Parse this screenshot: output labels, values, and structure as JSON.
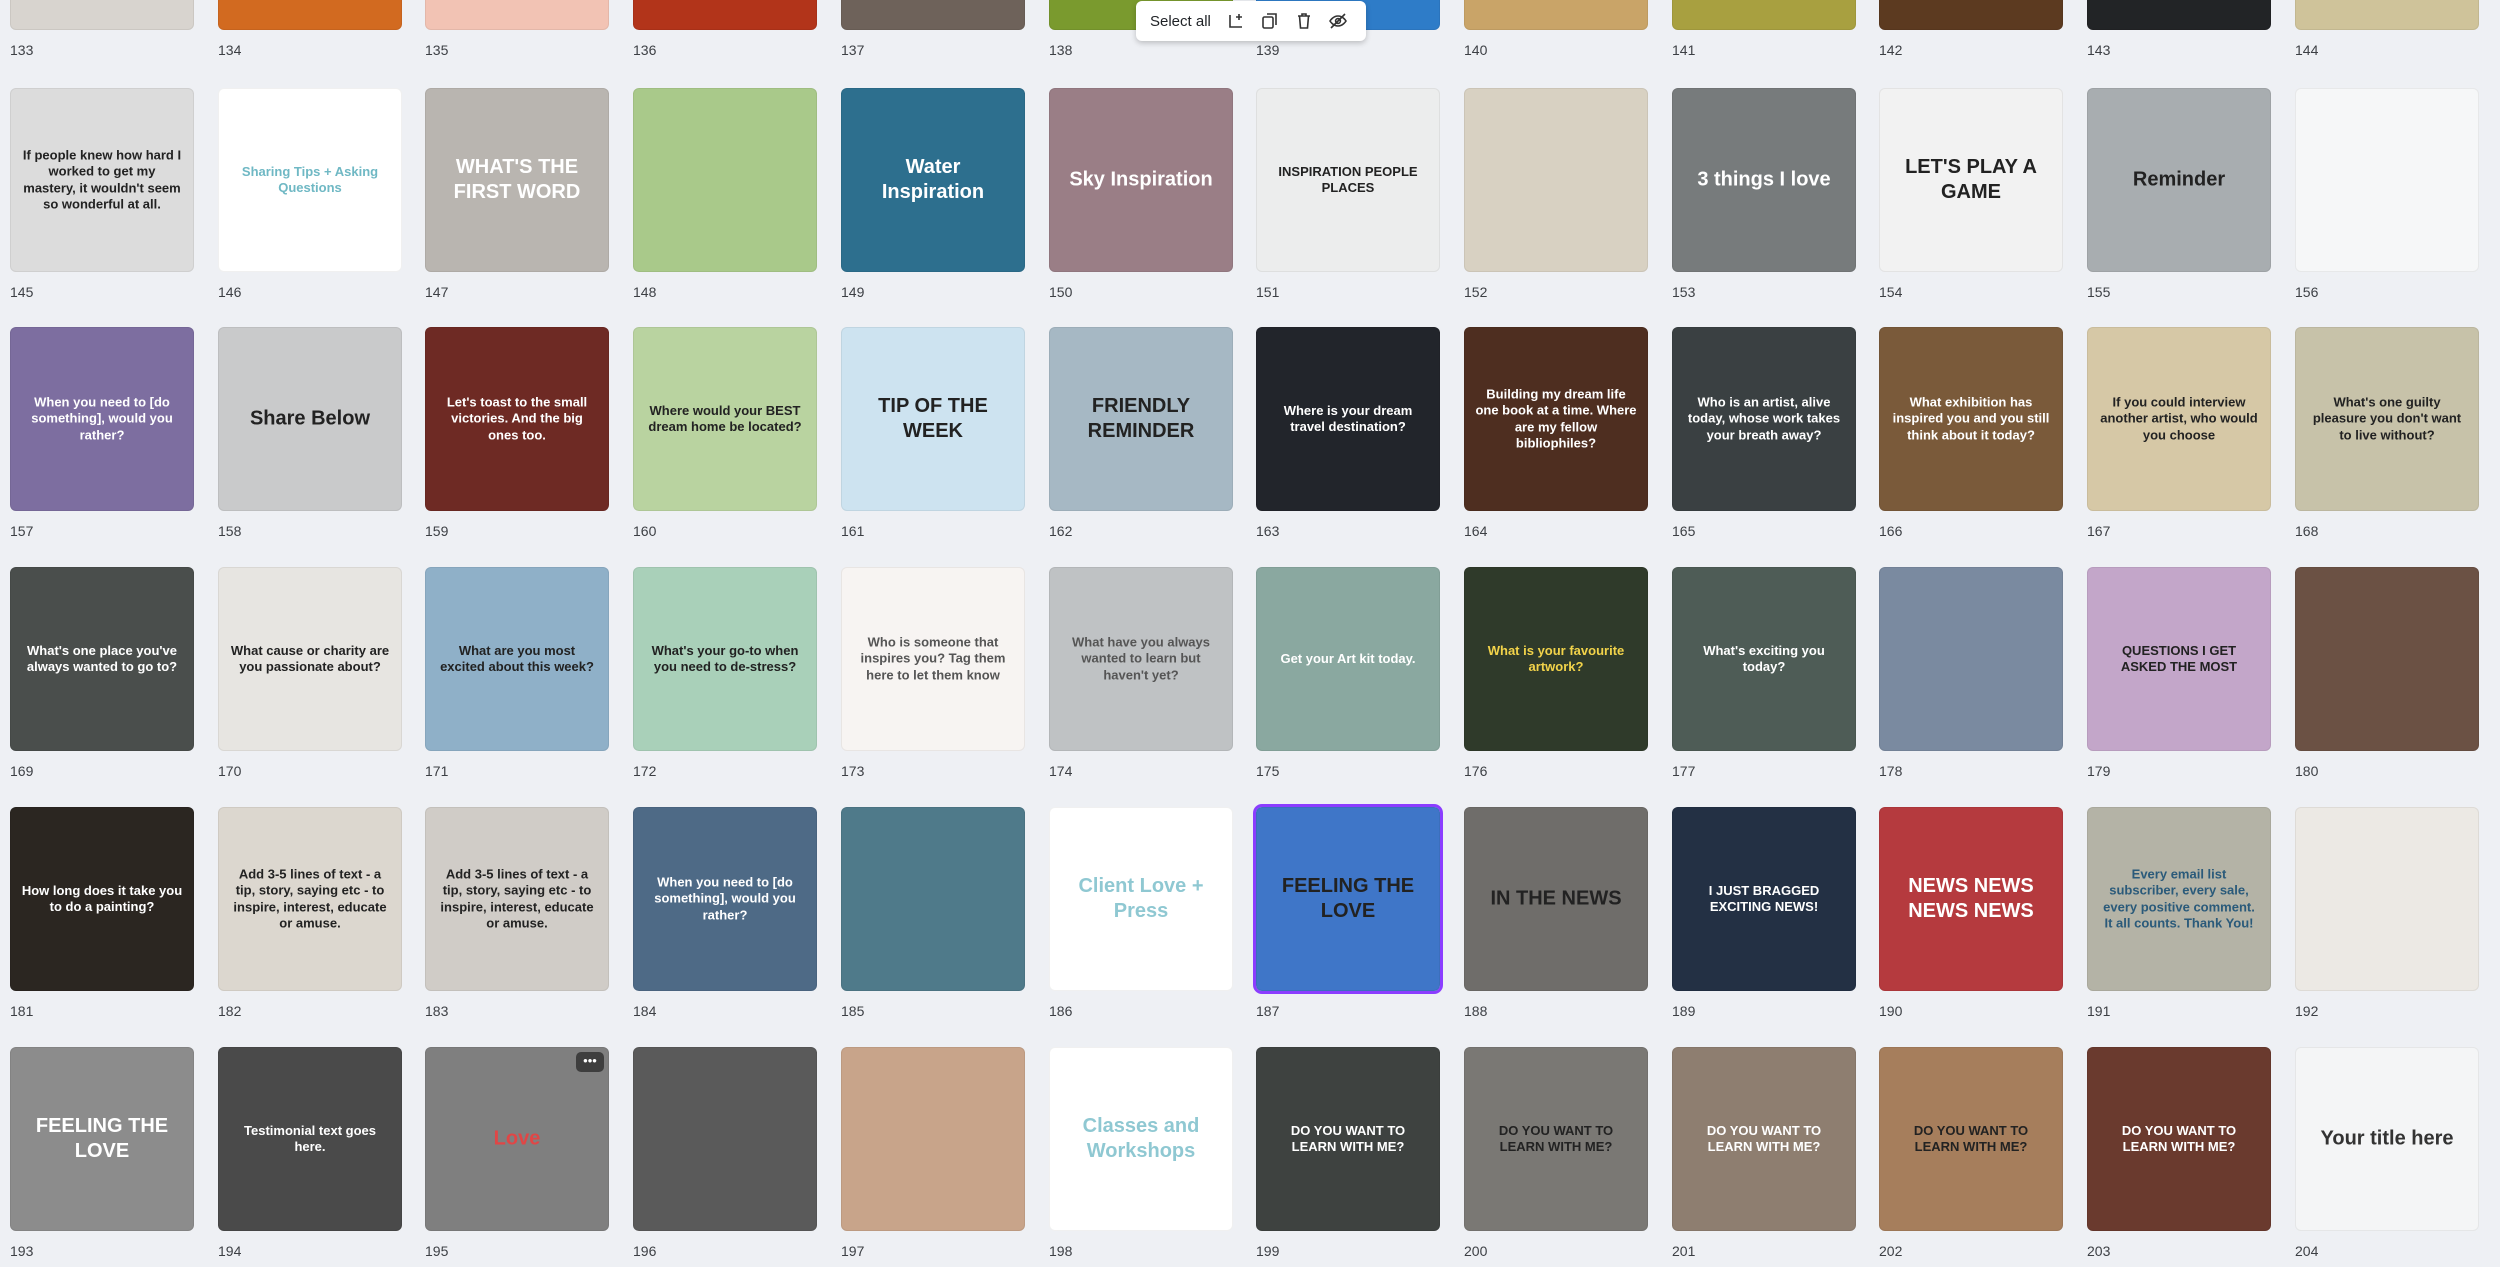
{
  "toolbar": {
    "select_all_label": "Select all"
  },
  "rows": [
    {
      "pages": [
        {
          "number": "133",
          "bg": "#d8d4cf",
          "text": "",
          "fg": "#333"
        },
        {
          "number": "134",
          "bg": "#d26a20",
          "text": "",
          "fg": "#fff"
        },
        {
          "number": "135",
          "bg": "#f2c3b4",
          "text": "",
          "fg": "#333"
        },
        {
          "number": "136",
          "bg": "#b2341a",
          "text": "",
          "fg": "#fff"
        },
        {
          "number": "137",
          "bg": "#6e625a",
          "text": "",
          "fg": "#fff"
        },
        {
          "number": "138",
          "bg": "#7a9a2e",
          "text": "",
          "fg": "#fff"
        },
        {
          "number": "139",
          "bg": "#2e7cc8",
          "text": "",
          "fg": "#fff"
        },
        {
          "number": "140",
          "bg": "#c9a468",
          "text": "",
          "fg": "#333"
        },
        {
          "number": "141",
          "bg": "#a8a040",
          "text": "",
          "fg": "#333"
        },
        {
          "number": "142",
          "bg": "#5c3a20",
          "text": "",
          "fg": "#fff"
        },
        {
          "number": "143",
          "bg": "#222426",
          "text": "",
          "fg": "#fff"
        },
        {
          "number": "144",
          "bg": "#cfc39a",
          "text": "",
          "fg": "#333"
        }
      ]
    },
    {
      "pages": [
        {
          "number": "145",
          "bg": "#dcdcdc",
          "text": "If people knew how hard I worked to get my mastery, it wouldn't seem so wonderful at all.",
          "fg": "#222"
        },
        {
          "number": "146",
          "bg": "#ffffff",
          "text": "Sharing Tips + Asking Questions",
          "fg": "#6fb8c4"
        },
        {
          "number": "147",
          "bg": "#b9b5b0",
          "text": "WHAT'S THE FIRST WORD",
          "fg": "#ffffff"
        },
        {
          "number": "148",
          "bg": "#a9c98a",
          "text": "",
          "fg": "#333"
        },
        {
          "number": "149",
          "bg": "#2d6f8e",
          "text": "Water Inspiration",
          "fg": "#ffffff"
        },
        {
          "number": "150",
          "bg": "#9a7e86",
          "text": "Sky Inspiration",
          "fg": "#ffffff"
        },
        {
          "number": "151",
          "bg": "#eceded",
          "text": "INSPIRATION PEOPLE PLACES",
          "fg": "#222"
        },
        {
          "number": "152",
          "bg": "#d8d1c2",
          "text": "",
          "fg": "#333"
        },
        {
          "number": "153",
          "bg": "#777b7c",
          "text": "3 things I love",
          "fg": "#ffffff"
        },
        {
          "number": "154",
          "bg": "#f2f2f2",
          "text": "LET'S PLAY A GAME",
          "fg": "#222"
        },
        {
          "number": "155",
          "bg": "#a8adb0",
          "text": "Reminder",
          "fg": "#222"
        },
        {
          "number": "156",
          "bg": "#f6f7f8",
          "text": "",
          "fg": "#333"
        }
      ]
    },
    {
      "pages": [
        {
          "number": "157",
          "bg": "#7d6ea0",
          "text": "When you need to [do something], would you rather?",
          "fg": "#ffffff"
        },
        {
          "number": "158",
          "bg": "#c9cacb",
          "text": "Share Below",
          "fg": "#222"
        },
        {
          "number": "159",
          "bg": "#6e2a24",
          "text": "Let's toast to the small victories. And the big ones too.",
          "fg": "#ffffff"
        },
        {
          "number": "160",
          "bg": "#b9d3a0",
          "text": "Where would your BEST dream home be located?",
          "fg": "#222"
        },
        {
          "number": "161",
          "bg": "#cde3f0",
          "text": "TIP OF THE WEEK",
          "fg": "#222"
        },
        {
          "number": "162",
          "bg": "#a6b8c4",
          "text": "FRIENDLY REMINDER",
          "fg": "#222"
        },
        {
          "number": "163",
          "bg": "#22252b",
          "text": "Where is your dream travel destination?",
          "fg": "#ffffff"
        },
        {
          "number": "164",
          "bg": "#4e2e20",
          "text": "Building my dream life one book at a time. Where are my fellow bibliophiles?",
          "fg": "#ffffff"
        },
        {
          "number": "165",
          "bg": "#3a4042",
          "text": "Who is an artist, alive today, whose work takes your breath away?",
          "fg": "#ffffff"
        },
        {
          "number": "166",
          "bg": "#7a5a3a",
          "text": "What exhibition has inspired you and you still think about it today?",
          "fg": "#ffffff"
        },
        {
          "number": "167",
          "bg": "#d6c8a6",
          "text": "If you could interview another artist, who would you choose",
          "fg": "#222"
        },
        {
          "number": "168",
          "bg": "#c7c2a9",
          "text": "What's one guilty pleasure you don't want to live without?",
          "fg": "#222"
        }
      ]
    },
    {
      "pages": [
        {
          "number": "169",
          "bg": "#4a4e4c",
          "text": "What's one place you've always wanted to go to?",
          "fg": "#ffffff"
        },
        {
          "number": "170",
          "bg": "#e7e5e1",
          "text": "What cause or charity are you passionate about?",
          "fg": "#222"
        },
        {
          "number": "171",
          "bg": "#8fb0c8",
          "text": "What are you most excited about this week?",
          "fg": "#222"
        },
        {
          "number": "172",
          "bg": "#a9d0b9",
          "text": "What's your go-to when you need to de-stress?",
          "fg": "#222"
        },
        {
          "number": "173",
          "bg": "#f7f4f2",
          "text": "Who is someone that inspires you? Tag them here to let them know",
          "fg": "#555"
        },
        {
          "number": "174",
          "bg": "#bfc2c4",
          "text": "What have you always wanted to learn but haven't yet?",
          "fg": "#555"
        },
        {
          "number": "175",
          "bg": "#8aa8a0",
          "text": "Get your Art kit today.",
          "fg": "#ffffff"
        },
        {
          "number": "176",
          "bg": "#2f3a2a",
          "text": "What is your favourite artwork?",
          "fg": "#f2d34a"
        },
        {
          "number": "177",
          "bg": "#4e5c56",
          "text": "What's exciting you today?",
          "fg": "#ffffff"
        },
        {
          "number": "178",
          "bg": "#7a8aa0",
          "text": "",
          "fg": "#fff"
        },
        {
          "number": "179",
          "bg": "#c3a6c9",
          "text": "QUESTIONS I GET ASKED THE MOST",
          "fg": "#222"
        },
        {
          "number": "180",
          "bg": "#6b5144",
          "text": "",
          "fg": "#fff"
        }
      ]
    },
    {
      "pages": [
        {
          "number": "181",
          "bg": "#2b2621",
          "text": "How long does it take you to do a painting?",
          "fg": "#ffffff"
        },
        {
          "number": "182",
          "bg": "#dcd7cf",
          "text": "Add 3-5 lines of text - a tip, story, saying etc - to inspire, interest, educate or amuse.",
          "fg": "#222"
        },
        {
          "number": "183",
          "bg": "#d0ccc7",
          "text": "Add 3-5 lines of text - a tip, story, saying etc - to inspire, interest, educate or amuse.",
          "fg": "#222"
        },
        {
          "number": "184",
          "bg": "#4e6a86",
          "text": "When you need to [do something], would you rather?",
          "fg": "#ffffff"
        },
        {
          "number": "185",
          "bg": "#4f7a8a",
          "text": "",
          "fg": "#fff"
        },
        {
          "number": "186",
          "bg": "#ffffff",
          "text": "Client Love + Press",
          "fg": "#8fc8d2"
        },
        {
          "number": "187",
          "bg": "#3f76c8",
          "text": "FEELING THE LOVE",
          "fg": "#222",
          "selected": true
        },
        {
          "number": "188",
          "bg": "#6f6d6a",
          "text": "IN THE NEWS",
          "fg": "#222"
        },
        {
          "number": "189",
          "bg": "#233044",
          "text": "I JUST BRAGGED EXCITING NEWS!",
          "fg": "#ffffff"
        },
        {
          "number": "190",
          "bg": "#b53a3e",
          "text": "NEWS NEWS NEWS NEWS",
          "fg": "#ffffff"
        },
        {
          "number": "191",
          "bg": "#b4b3a6",
          "text": "Every email list subscriber, every sale, every positive comment. It all counts. Thank You!",
          "fg": "#2a5a7a"
        },
        {
          "number": "192",
          "bg": "#ece9e4",
          "text": "",
          "fg": "#333"
        }
      ]
    },
    {
      "pages": [
        {
          "number": "193",
          "bg": "#8c8c8c",
          "text": "FEELING THE LOVE",
          "fg": "#ffffff"
        },
        {
          "number": "194",
          "bg": "#4a4a4a",
          "text": "Testimonial text goes here.",
          "fg": "#ffffff"
        },
        {
          "number": "195",
          "bg": "#7f7f7f",
          "text": "Love",
          "fg": "#e04646",
          "more": true
        },
        {
          "number": "196",
          "bg": "#5a5a5a",
          "text": "",
          "fg": "#fff"
        },
        {
          "number": "197",
          "bg": "#c8a48a",
          "text": "",
          "fg": "#fff"
        },
        {
          "number": "198",
          "bg": "#ffffff",
          "text": "Classes and Workshops",
          "fg": "#8fc8d2"
        },
        {
          "number": "199",
          "bg": "#3e4240",
          "text": "DO YOU WANT TO LEARN WITH ME?",
          "fg": "#ffffff"
        },
        {
          "number": "200",
          "bg": "#7a7874",
          "text": "DO YOU WANT TO LEARN WITH ME?",
          "fg": "#222"
        },
        {
          "number": "201",
          "bg": "#8e7e70",
          "text": "DO YOU WANT TO LEARN WITH ME?",
          "fg": "#ffffff"
        },
        {
          "number": "202",
          "bg": "#a67e5c",
          "text": "DO YOU WANT TO LEARN WITH ME?",
          "fg": "#222"
        },
        {
          "number": "203",
          "bg": "#6a3a2e",
          "text": "DO YOU WANT TO LEARN WITH ME?",
          "fg": "#ffffff"
        },
        {
          "number": "204",
          "bg": "#f4f5f6",
          "text": "Your title here",
          "fg": "#333"
        }
      ]
    }
  ]
}
